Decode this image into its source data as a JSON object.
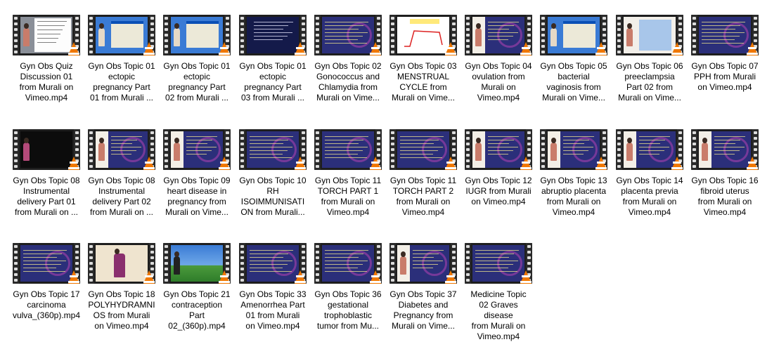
{
  "files": [
    {
      "name": "Gyn Obs Quiz\nDiscussion 01\nfrom Murali on\nVimeo.mp4",
      "thumb": "quiz"
    },
    {
      "name": "Gyn Obs Topic 01\nectopic\npregnancy Part\n01 from Murali ...",
      "thumb": "xp-window"
    },
    {
      "name": "Gyn Obs Topic 01\nectopic\npregnancy Part\n02 from Murali ...",
      "thumb": "xp-window"
    },
    {
      "name": "Gyn Obs Topic 01\nectopic\npregnancy Part\n03 from Murali ...",
      "thumb": "slide-dark"
    },
    {
      "name": "Gyn Obs Topic 02\nGonococcus and\nChlamydia from\nMurali on Vime...",
      "thumb": "slide"
    },
    {
      "name": "Gyn Obs Topic 03\nMENSTRUAL\nCYCLE from\nMurali on Vime...",
      "thumb": "white-chart"
    },
    {
      "name": "Gyn Obs Topic 04\novulation from\nMurali on\nVimeo.mp4",
      "thumb": "slide-person"
    },
    {
      "name": "Gyn Obs Topic 05\nbacterial\nvaginosis from\nMurali on Vime...",
      "thumb": "xp-window"
    },
    {
      "name": "Gyn Obs Topic 06\npreeclampsia\nPart 02 from\nMurali on Vime...",
      "thumb": "blue-box"
    },
    {
      "name": "Gyn Obs Topic 07\nPPH from Murali\non Vimeo.mp4",
      "thumb": "slide"
    },
    {
      "name": "Gyn Obs Topic 08\nInstrumental\ndelivery Part 01\nfrom Murali on ...",
      "thumb": "black"
    },
    {
      "name": "Gyn Obs Topic 08\nInstrumental\ndelivery Part 02\nfrom Murali on ...",
      "thumb": "slide-person"
    },
    {
      "name": "Gyn Obs Topic 09\nheart disease in\npregnancy from\nMurali on Vime...",
      "thumb": "slide-person"
    },
    {
      "name": "Gyn Obs Topic 10\nRH\nISOIMMUNISATI\nON from Murali...",
      "thumb": "slide"
    },
    {
      "name": "Gyn Obs Topic 11\nTORCH PART 1\nfrom Murali on\nVimeo.mp4",
      "thumb": "slide"
    },
    {
      "name": "Gyn Obs Topic 11\nTORCH PART 2\nfrom Murali on\nVimeo.mp4",
      "thumb": "slide"
    },
    {
      "name": "Gyn Obs Topic 12\nIUGR from Murali\non Vimeo.mp4",
      "thumb": "slide-person"
    },
    {
      "name": "Gyn Obs Topic 13\nabruptio placenta\nfrom Murali on\nVimeo.mp4",
      "thumb": "slide-person"
    },
    {
      "name": "Gyn Obs Topic 14\nplacenta previa\nfrom Murali on\nVimeo.mp4",
      "thumb": "slide-person"
    },
    {
      "name": "Gyn Obs Topic 16\nfibroid uterus\nfrom Murali on\nVimeo.mp4",
      "thumb": "slide-person"
    },
    {
      "name": "Gyn Obs Topic 17\ncarcinoma\nvulva_(360p).mp4",
      "thumb": "slide"
    },
    {
      "name": "Gyn Obs Topic 18\nPOLYHYDRAMNI\nOS from Murali\non Vimeo.mp4",
      "thumb": "person-cream"
    },
    {
      "name": "Gyn Obs Topic 21\ncontraception\nPart\n02_(360p).mp4",
      "thumb": "xp-desktop"
    },
    {
      "name": "Gyn Obs Topic 33\nAmenorrhea Part\n01 from Murali\non Vimeo.mp4",
      "thumb": "slide"
    },
    {
      "name": "Gyn Obs Topic 36\ngestational\ntrophoblastic\ntumor from Mu...",
      "thumb": "slide"
    },
    {
      "name": "Gyn Obs Topic 37\nDiabetes and\nPregnancy from\nMurali on Vime...",
      "thumb": "slide-person"
    },
    {
      "name": "Medicine Topic\n02 Graves disease\nfrom Murali on\nVimeo.mp4",
      "thumb": "slide"
    }
  ],
  "overlay_icon": "vlc-cone-icon",
  "colors": {
    "slide_bg": "#2b2f7a",
    "vlc_orange": "#f07800",
    "film_strip": "#2a2a2a",
    "xp_desktop": "#3a7bd5"
  }
}
